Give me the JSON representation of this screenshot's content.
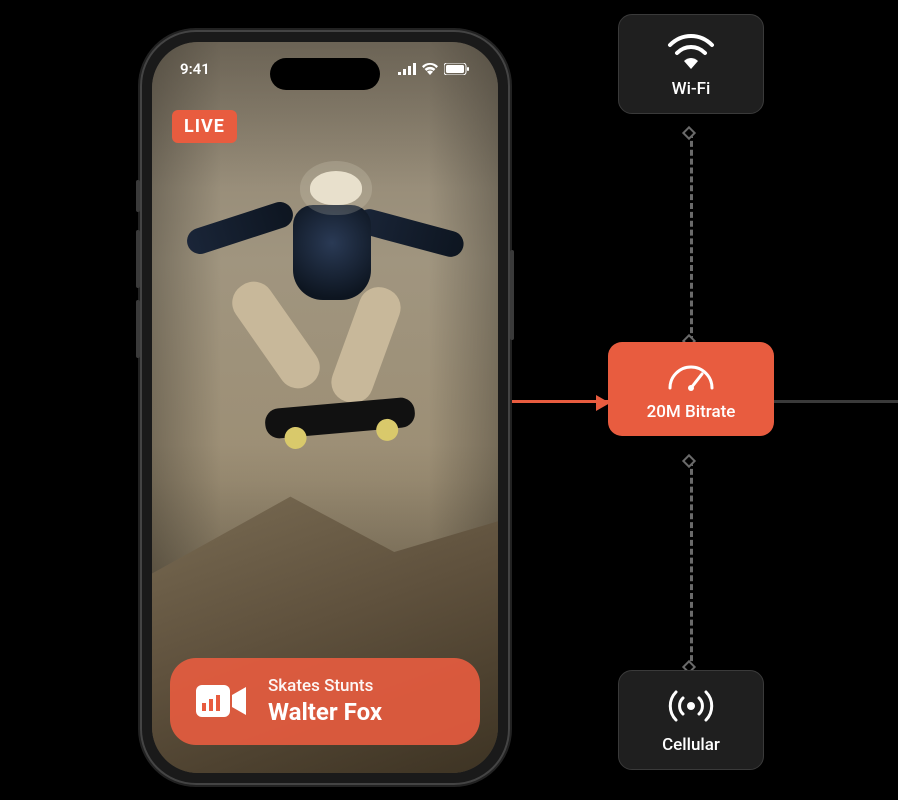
{
  "phone": {
    "status_time": "9:41",
    "live_label": "LIVE",
    "stream": {
      "subtitle": "Skates Stunts",
      "streamer_name": "Walter Fox"
    }
  },
  "network": {
    "wifi_label": "Wi-Fi",
    "bitrate_label": "20M Bitrate",
    "cellular_label": "Cellular"
  },
  "colors": {
    "accent": "#e85c3f",
    "node_dark": "#1f1f1f"
  }
}
